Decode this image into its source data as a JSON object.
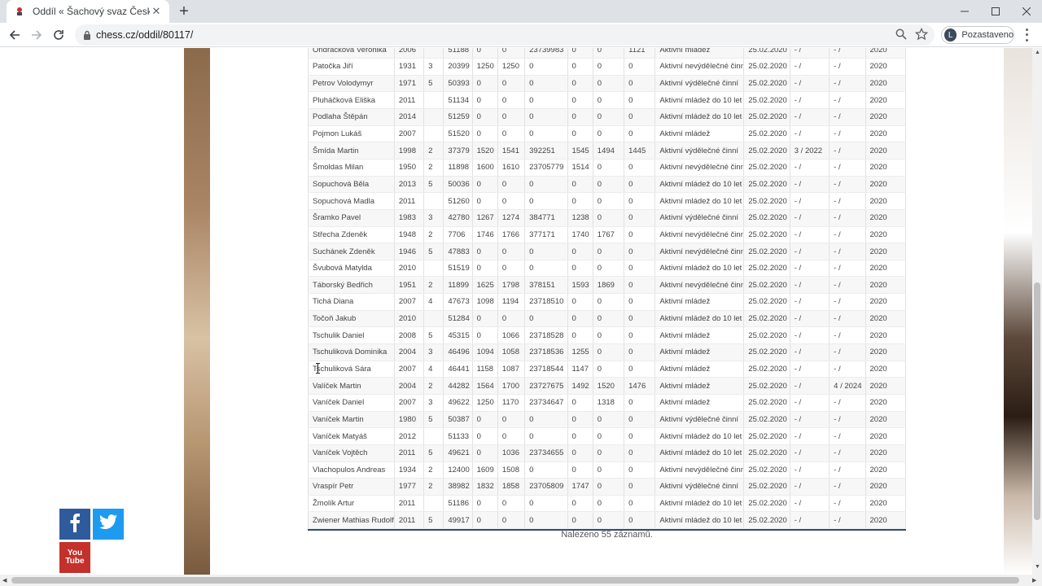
{
  "browser": {
    "tab_title": "Oddíl « Šachový svaz České repu",
    "url": "chess.cz/oddil/80117/",
    "profile_initial": "L",
    "profile_status": "Pozastaveno"
  },
  "table": {
    "rows": [
      [
        "Ondráčková Veronika",
        "2006",
        "",
        "51188",
        "0",
        "0",
        "23739983",
        "0",
        "0",
        "1121",
        "Aktivní mládež",
        "25.02.2020",
        "- /",
        "- /",
        "2020"
      ],
      [
        "Patočka Jiří",
        "1931",
        "3",
        "20399",
        "1250",
        "1250",
        "0",
        "0",
        "0",
        "0",
        "Aktivní nevýdělečné činní",
        "25.02.2020",
        "- /",
        "- /",
        "2020"
      ],
      [
        "Petrov Volodymyr",
        "1971",
        "5",
        "50393",
        "0",
        "0",
        "0",
        "0",
        "0",
        "0",
        "Aktivní výdělečné činní",
        "25.02.2020",
        "- /",
        "- /",
        "2020"
      ],
      [
        "Pluháčková Eliška",
        "2011",
        "",
        "51134",
        "0",
        "0",
        "0",
        "0",
        "0",
        "0",
        "Aktivní mládež do 10 let",
        "25.02.2020",
        "- /",
        "- /",
        "2020"
      ],
      [
        "Podlaha Štěpán",
        "2014",
        "",
        "51259",
        "0",
        "0",
        "0",
        "0",
        "0",
        "0",
        "Aktivní mládež do 10 let",
        "25.02.2020",
        "- /",
        "- /",
        "2020"
      ],
      [
        "Pojmon Lukáš",
        "2007",
        "",
        "51520",
        "0",
        "0",
        "0",
        "0",
        "0",
        "0",
        "Aktivní mládež",
        "25.02.2020",
        "- /",
        "- /",
        "2020"
      ],
      [
        "Šmída Martin",
        "1998",
        "2",
        "37379",
        "1520",
        "1541",
        "392251",
        "1545",
        "1494",
        "1445",
        "Aktivní výdělečné činní",
        "25.02.2020",
        "3 / 2022",
        "- /",
        "2020"
      ],
      [
        "Šmoldas Milan",
        "1950",
        "2",
        "11898",
        "1600",
        "1610",
        "23705779",
        "1514",
        "0",
        "0",
        "Aktivní nevýdělečné činní",
        "25.02.2020",
        "- /",
        "- /",
        "2020"
      ],
      [
        "Sopuchová Běla",
        "2013",
        "5",
        "50036",
        "0",
        "0",
        "0",
        "0",
        "0",
        "0",
        "Aktivní mládež do 10 let",
        "25.02.2020",
        "- /",
        "- /",
        "2020"
      ],
      [
        "Sopuchová Madla",
        "2011",
        "",
        "51260",
        "0",
        "0",
        "0",
        "0",
        "0",
        "0",
        "Aktivní mládež do 10 let",
        "25.02.2020",
        "- /",
        "- /",
        "2020"
      ],
      [
        "Šramko Pavel",
        "1983",
        "3",
        "42780",
        "1267",
        "1274",
        "384771",
        "1238",
        "0",
        "0",
        "Aktivní výdělečné činní",
        "25.02.2020",
        "- /",
        "- /",
        "2020"
      ],
      [
        "Střecha Zdeněk",
        "1948",
        "2",
        "7706",
        "1746",
        "1766",
        "377171",
        "1740",
        "1767",
        "0",
        "Aktivní nevýdělečné činní",
        "25.02.2020",
        "- /",
        "- /",
        "2020"
      ],
      [
        "Suchánek Zdeněk",
        "1946",
        "5",
        "47883",
        "0",
        "0",
        "0",
        "0",
        "0",
        "0",
        "Aktivní nevýdělečné činní",
        "25.02.2020",
        "- /",
        "- /",
        "2020"
      ],
      [
        "Švubová Matylda",
        "2010",
        "",
        "51519",
        "0",
        "0",
        "0",
        "0",
        "0",
        "0",
        "Aktivní mládež do 10 let",
        "25.02.2020",
        "- /",
        "- /",
        "2020"
      ],
      [
        "Táborský Bedřich",
        "1951",
        "2",
        "11899",
        "1625",
        "1798",
        "378151",
        "1593",
        "1869",
        "0",
        "Aktivní nevýdělečné činní",
        "25.02.2020",
        "- /",
        "- /",
        "2020"
      ],
      [
        "Tichá Diana",
        "2007",
        "4",
        "47673",
        "1098",
        "1194",
        "23718510",
        "0",
        "0",
        "0",
        "Aktivní mládež",
        "25.02.2020",
        "- /",
        "- /",
        "2020"
      ],
      [
        "Točoň Jakub",
        "2010",
        "",
        "51284",
        "0",
        "0",
        "0",
        "0",
        "0",
        "0",
        "Aktivní mládež do 10 let",
        "25.02.2020",
        "- /",
        "- /",
        "2020"
      ],
      [
        "Tschulik Daniel",
        "2008",
        "5",
        "45315",
        "0",
        "1066",
        "23718528",
        "0",
        "0",
        "0",
        "Aktivní mládež",
        "25.02.2020",
        "- /",
        "- /",
        "2020"
      ],
      [
        "Tschuliková Dominika",
        "2004",
        "3",
        "46496",
        "1094",
        "1058",
        "23718536",
        "1255",
        "0",
        "0",
        "Aktivní mládež",
        "25.02.2020",
        "- /",
        "- /",
        "2020"
      ],
      [
        "Tschuliková Sára",
        "2007",
        "4",
        "46441",
        "1158",
        "1087",
        "23718544",
        "1147",
        "0",
        "0",
        "Aktivní mládež",
        "25.02.2020",
        "- /",
        "- /",
        "2020"
      ],
      [
        "Valíček Martin",
        "2004",
        "2",
        "44282",
        "1564",
        "1700",
        "23727675",
        "1492",
        "1520",
        "1476",
        "Aktivní mládež",
        "25.02.2020",
        "- /",
        "4 / 2024",
        "2020"
      ],
      [
        "Vaníček Daniel",
        "2007",
        "3",
        "49622",
        "1250",
        "1170",
        "23734647",
        "0",
        "1318",
        "0",
        "Aktivní mládež",
        "25.02.2020",
        "- /",
        "- /",
        "2020"
      ],
      [
        "Vaníček Martin",
        "1980",
        "5",
        "50387",
        "0",
        "0",
        "0",
        "0",
        "0",
        "0",
        "Aktivní výdělečné činní",
        "25.02.2020",
        "- /",
        "- /",
        "2020"
      ],
      [
        "Vaníček Matyáš",
        "2012",
        "",
        "51133",
        "0",
        "0",
        "0",
        "0",
        "0",
        "0",
        "Aktivní mládež do 10 let",
        "25.02.2020",
        "- /",
        "- /",
        "2020"
      ],
      [
        "Vaníček Vojtěch",
        "2011",
        "5",
        "49621",
        "0",
        "1036",
        "23734655",
        "0",
        "0",
        "0",
        "Aktivní mládež do 10 let",
        "25.02.2020",
        "- /",
        "- /",
        "2020"
      ],
      [
        "Vlachopulos Andreas",
        "1934",
        "2",
        "12400",
        "1609",
        "1508",
        "0",
        "0",
        "0",
        "0",
        "Aktivní nevýdělečné činní",
        "25.02.2020",
        "- /",
        "- /",
        "2020"
      ],
      [
        "Vraspír Petr",
        "1977",
        "2",
        "38982",
        "1832",
        "1858",
        "23705809",
        "1747",
        "0",
        "0",
        "Aktivní výdělečné činní",
        "25.02.2020",
        "- /",
        "- /",
        "2020"
      ],
      [
        "Žmolík Artur",
        "2011",
        "",
        "51186",
        "0",
        "0",
        "0",
        "0",
        "0",
        "0",
        "Aktivní mládež do 10 let",
        "25.02.2020",
        "- /",
        "- /",
        "2020"
      ],
      [
        "Zwiener Mathias Rudolf",
        "2011",
        "5",
        "49917",
        "0",
        "0",
        "0",
        "0",
        "0",
        "0",
        "Aktivní mládež do 10 let",
        "25.02.2020",
        "- /",
        "- /",
        "2020"
      ]
    ],
    "footer": "Nalezeno 55 záznamů."
  },
  "social": {
    "facebook_icon": "facebook-icon",
    "twitter_icon": "twitter-icon",
    "youtube_label": "You Tube"
  }
}
